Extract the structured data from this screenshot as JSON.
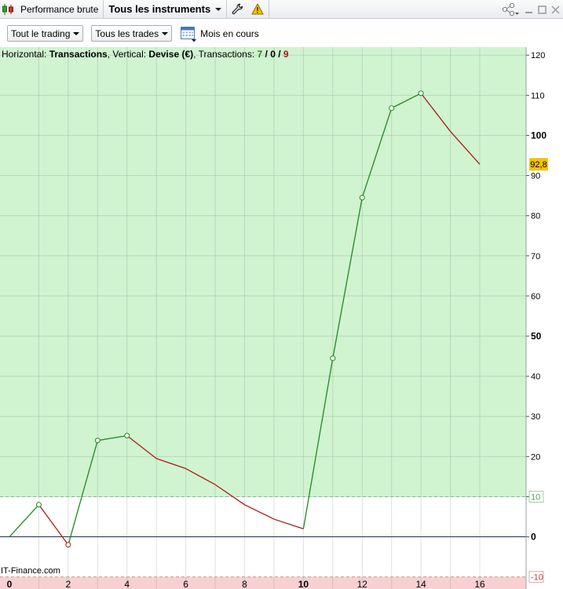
{
  "titlebar": {
    "tab_performance": "Performance brute",
    "tab_instruments": "Tous les instruments"
  },
  "toolbar": {
    "scope_label": "Tout le trading",
    "trades_label": "Tous les trades",
    "period_label": "Mois en cours"
  },
  "info": {
    "h_prefix": "Horizontal: ",
    "h_value": "Transactions",
    "v_prefix": ", Vertical: ",
    "v_value": "Devise (€)",
    "t_prefix": ", Transactions: ",
    "t_wins": "7",
    "t_sep1": " / ",
    "t_even": "0",
    "t_sep2": " / ",
    "t_losses": "9"
  },
  "watermark": "IT-Finance.com",
  "last_value_label": "92,8",
  "colors": {
    "profit_zone": "#d0f3d0",
    "loss_zone": "#f7d1d1",
    "up_segment": "#1e8a1e",
    "down_segment": "#aa1b1b",
    "zero_line": "#1f2a66",
    "last_badge": "#f4c300"
  },
  "chart_data": {
    "type": "line",
    "x": [
      0,
      1,
      2,
      3,
      4,
      5,
      6,
      7,
      8,
      9,
      10,
      11,
      12,
      13,
      14,
      15,
      16
    ],
    "y": [
      0,
      8,
      -2,
      24,
      25.2,
      19.5,
      17,
      13,
      8,
      4.4,
      2,
      44.5,
      84.5,
      106.8,
      110.5,
      101,
      92.8
    ],
    "markers": [
      1,
      2,
      3,
      4,
      11,
      12,
      13,
      14
    ],
    "xlim": [
      0,
      17.6
    ],
    "ylim": [
      -13,
      122
    ],
    "x_ticks": [
      "0",
      "2",
      "4",
      "6",
      "8",
      "10",
      "12",
      "14",
      "16"
    ],
    "y_ticks": [
      "120",
      "110",
      "100",
      "90",
      "80",
      "70",
      "60",
      "50",
      "40",
      "30",
      "20",
      "10",
      "0"
    ],
    "threshold_labels": [
      "10",
      "-10"
    ],
    "grid": true
  }
}
